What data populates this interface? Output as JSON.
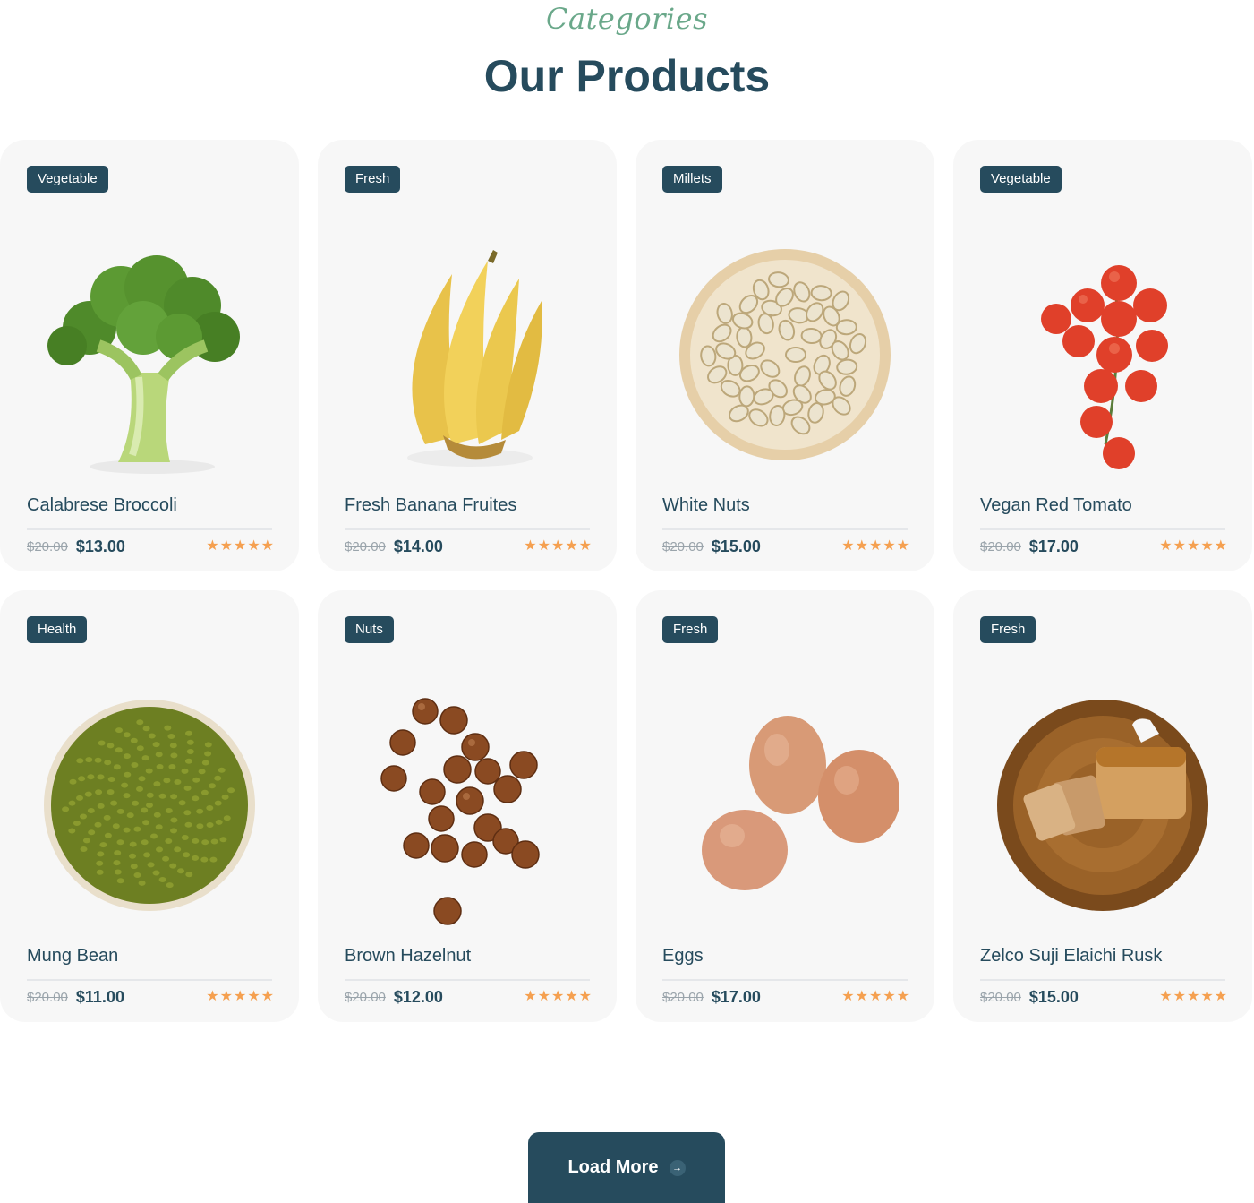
{
  "section": {
    "subtitle": "Categories",
    "title": "Our Products"
  },
  "colors": {
    "primary": "#264b5d",
    "accent_green": "#6aa88a",
    "star": "#f5a050",
    "card_bg": "#f7f7f7"
  },
  "products": [
    {
      "badge": "Vegetable",
      "name": "Calabrese Broccoli",
      "old_price": "$20.00",
      "price": "$13.00",
      "rating": 5,
      "image_icon": "broccoli"
    },
    {
      "badge": "Fresh",
      "name": "Fresh Banana Fruites",
      "old_price": "$20.00",
      "price": "$14.00",
      "rating": 5,
      "image_icon": "banana"
    },
    {
      "badge": "Millets",
      "name": "White Nuts",
      "old_price": "$20.00",
      "price": "$15.00",
      "rating": 5,
      "image_icon": "pistachio-bowl"
    },
    {
      "badge": "Vegetable",
      "name": "Vegan Red Tomato",
      "old_price": "$20.00",
      "price": "$17.00",
      "rating": 5,
      "image_icon": "cherry-tomatoes"
    },
    {
      "badge": "Health",
      "name": "Mung Bean",
      "old_price": "$20.00",
      "price": "$11.00",
      "rating": 5,
      "image_icon": "mung-bean-bowl"
    },
    {
      "badge": "Nuts",
      "name": "Brown Hazelnut",
      "old_price": "$20.00",
      "price": "$12.00",
      "rating": 5,
      "image_icon": "hazelnuts"
    },
    {
      "badge": "Fresh",
      "name": "Eggs",
      "old_price": "$20.00",
      "price": "$17.00",
      "rating": 5,
      "image_icon": "eggs"
    },
    {
      "badge": "Fresh",
      "name": "Zelco Suji Elaichi Rusk",
      "old_price": "$20.00",
      "price": "$15.00",
      "rating": 5,
      "image_icon": "rusk-board"
    }
  ],
  "load_more": {
    "label": "Load More",
    "icon": "arrow-right-icon"
  }
}
